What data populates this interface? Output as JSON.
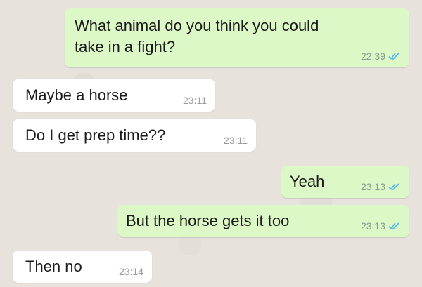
{
  "messages": [
    {
      "direction": "outgoing",
      "text": "What animal do you think you could\ntake in a fight?",
      "time": "22:39",
      "status_icon": "double-check-read-icon"
    },
    {
      "direction": "incoming",
      "text": "Maybe a horse",
      "time": "23:11"
    },
    {
      "direction": "incoming",
      "text": "Do I get prep time??",
      "time": "23:11"
    },
    {
      "direction": "outgoing",
      "text": "Yeah",
      "time": "23:13",
      "status_icon": "double-check-read-icon"
    },
    {
      "direction": "outgoing",
      "text": "But the horse gets it too",
      "time": "23:13",
      "status_icon": "double-check-read-icon"
    },
    {
      "direction": "incoming",
      "text": "Then no",
      "time": "23:14"
    }
  ],
  "colors": {
    "outgoing_bubble": "#dcf8c6",
    "incoming_bubble": "#ffffff",
    "read_ticks": "#4fb6ec",
    "background": "#e8e2dd"
  }
}
